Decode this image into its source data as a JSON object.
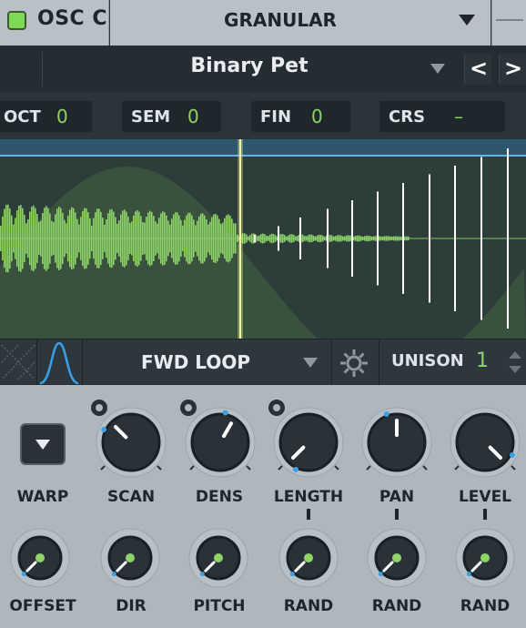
{
  "header": {
    "osc_title": "OSC C",
    "mode": "GRANULAR"
  },
  "preset": {
    "name": "Binary Pet",
    "prev_label": "<",
    "next_label": ">"
  },
  "pitch": {
    "oct_label": "OCT",
    "oct_value": "0",
    "sem_label": "SEM",
    "sem_value": "0",
    "fin_label": "FIN",
    "fin_value": "0",
    "crs_label": "CRS",
    "crs_value": "–"
  },
  "toolbar": {
    "playback_mode": "FWD LOOP",
    "unison_label": "UNISON",
    "unison_value": "1"
  },
  "knobs_row1": {
    "warp": "WARP",
    "scan": "SCAN",
    "dens": "DENS",
    "length": "LENGTH",
    "pan": "PAN",
    "level": "LEVEL"
  },
  "knobs_row2": {
    "offset": "OFFSET",
    "dir": "DIR",
    "pitch": "PITCH",
    "rand1": "RAND",
    "rand2": "RAND",
    "rand3": "RAND"
  },
  "colors": {
    "accent_green": "#8dd36a",
    "accent_blue": "#3aa0e6",
    "playhead": "#e6f08a",
    "panel": "#aeb6be"
  }
}
